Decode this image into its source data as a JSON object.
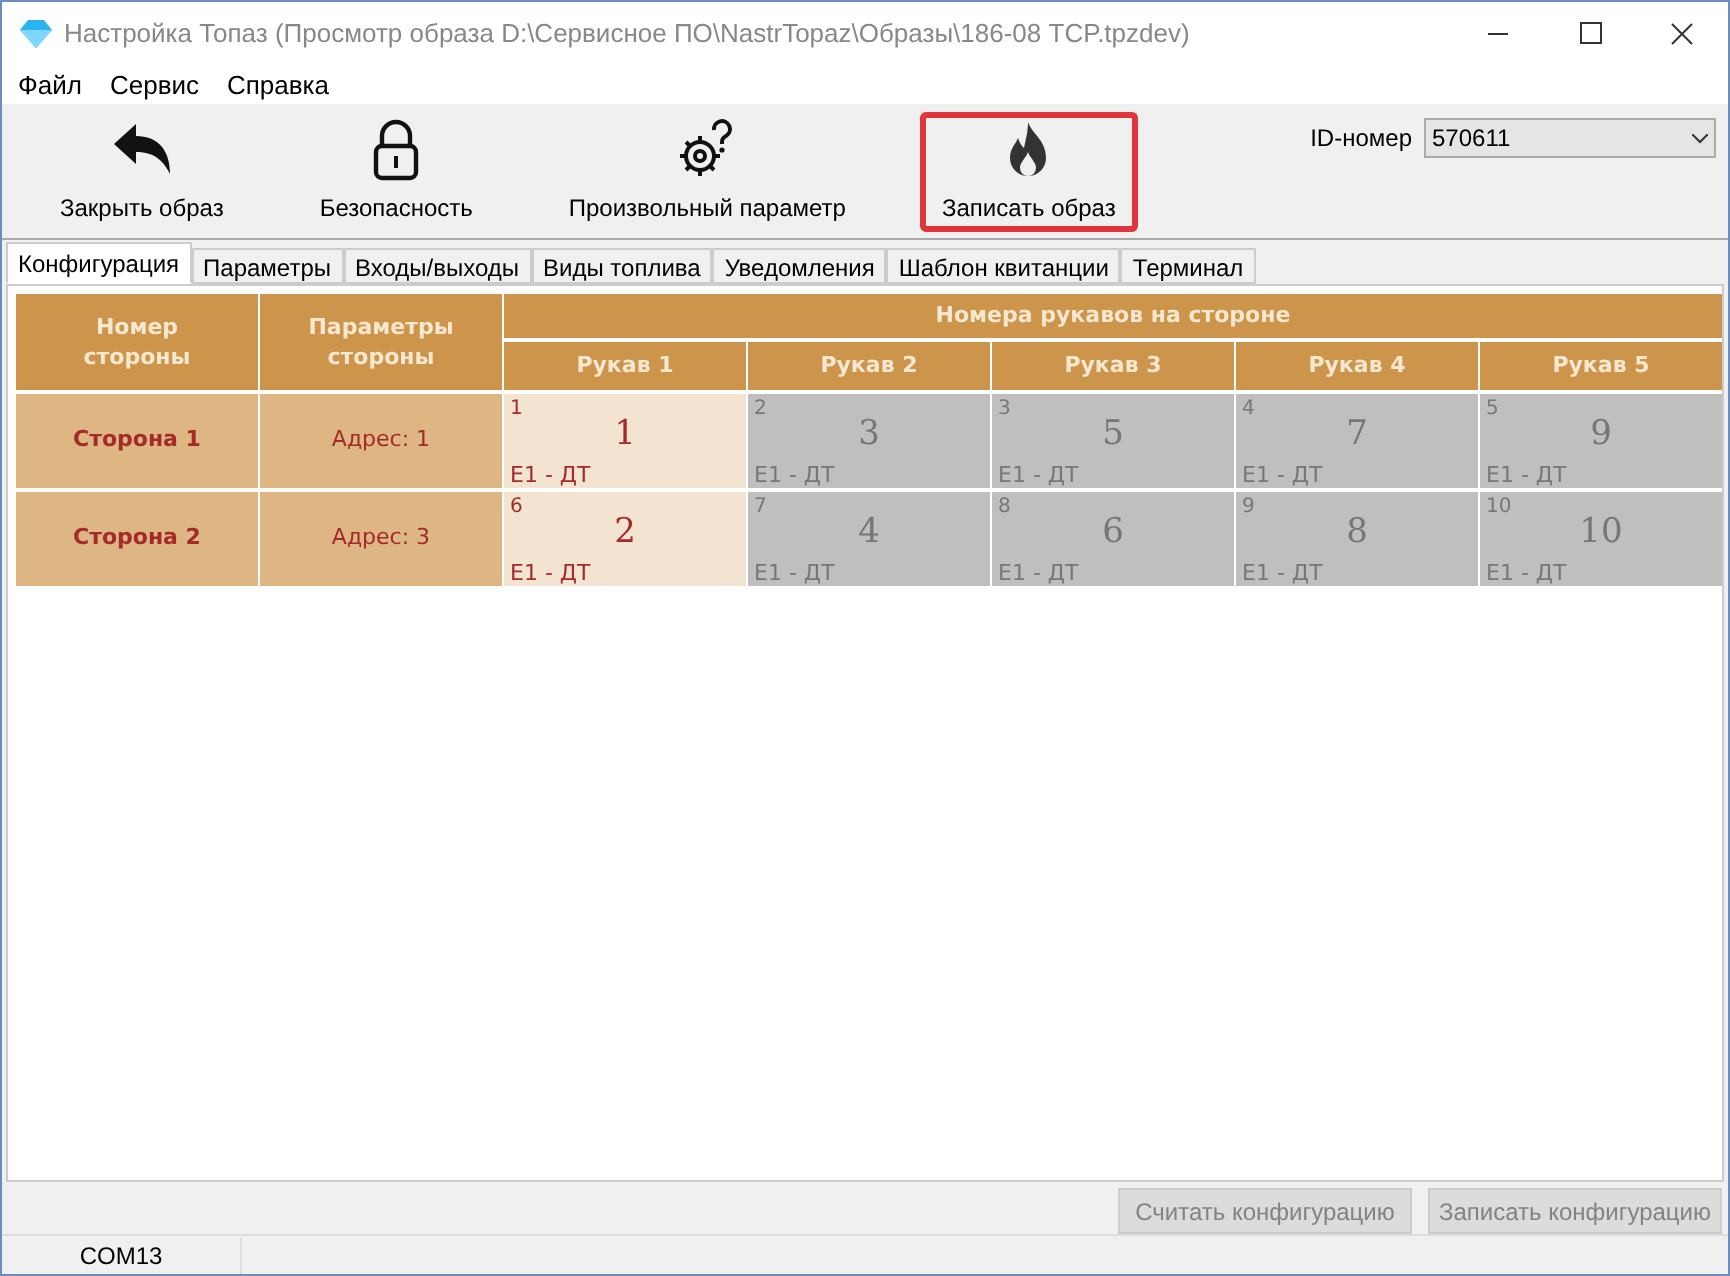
{
  "window": {
    "title": "Настройка Топаз (Просмотр образа D:\\Сервисное ПО\\NastrTopaz\\Образы\\186-08 TCP.tpzdev)"
  },
  "menu": [
    "Файл",
    "Сервис",
    "Справка"
  ],
  "toolbar": [
    {
      "kind": "back",
      "label": "Закрыть образ",
      "highlighted": false
    },
    {
      "kind": "lock",
      "label": "Безопасность",
      "highlighted": false
    },
    {
      "kind": "gear",
      "label": "Произвольный параметр",
      "highlighted": false
    },
    {
      "kind": "fire",
      "label": "Записать образ",
      "highlighted": true
    }
  ],
  "id_field": {
    "label": "ID-номер",
    "value": "570611"
  },
  "tabs": [
    {
      "label": "Конфигурация",
      "selected": true
    },
    {
      "label": "Параметры",
      "selected": false
    },
    {
      "label": "Входы/выходы",
      "selected": false
    },
    {
      "label": "Виды топлива",
      "selected": false
    },
    {
      "label": "Уведомления",
      "selected": false
    },
    {
      "label": "Шаблон квитанции",
      "selected": false
    },
    {
      "label": "Терминал",
      "selected": false
    }
  ],
  "table": {
    "col_side": "Номер стороны",
    "col_params": "Параметры стороны",
    "group": "Номера рукавов на стороне",
    "hoses": [
      "Рукав 1",
      "Рукав 2",
      "Рукав 3",
      "Рукав 4",
      "Рукав 5"
    ],
    "rows": [
      {
        "side": "Сторона 1",
        "address": "Адрес: 1",
        "cells": [
          {
            "index": "1",
            "number": "1",
            "fuel": "E1 - ДТ",
            "active": true
          },
          {
            "index": "2",
            "number": "3",
            "fuel": "E1 - ДТ",
            "active": false
          },
          {
            "index": "3",
            "number": "5",
            "fuel": "E1 - ДТ",
            "active": false
          },
          {
            "index": "4",
            "number": "7",
            "fuel": "E1 - ДТ",
            "active": false
          },
          {
            "index": "5",
            "number": "9",
            "fuel": "E1 - ДТ",
            "active": false
          }
        ]
      },
      {
        "side": "Сторона 2",
        "address": "Адрес: 3",
        "cells": [
          {
            "index": "6",
            "number": "2",
            "fuel": "E1 - ДТ",
            "active": true
          },
          {
            "index": "7",
            "number": "4",
            "fuel": "E1 - ДТ",
            "active": false
          },
          {
            "index": "8",
            "number": "6",
            "fuel": "E1 - ДТ",
            "active": false
          },
          {
            "index": "9",
            "number": "8",
            "fuel": "E1 - ДТ",
            "active": false
          },
          {
            "index": "10",
            "number": "10",
            "fuel": "E1 - ДТ",
            "active": false
          }
        ]
      }
    ]
  },
  "buttons": [
    {
      "label": "Считать конфигурацию",
      "disabled": true
    },
    {
      "label": "Записать конфигурацию",
      "disabled": true
    }
  ],
  "status_bar": [
    "COM13"
  ]
}
